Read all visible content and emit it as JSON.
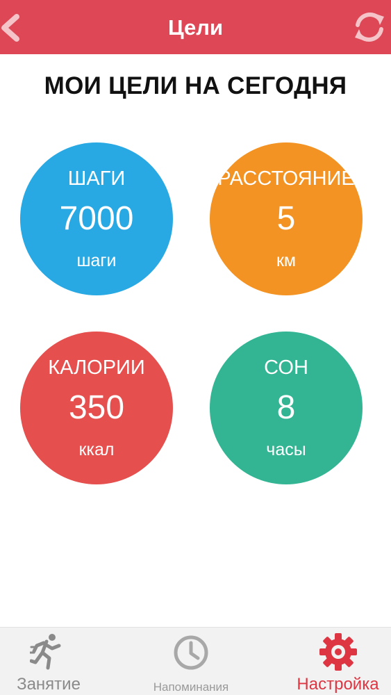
{
  "colors": {
    "header": "#dd4756",
    "steps": "#29a9e3",
    "distance": "#f39323",
    "calories": "#e5504e",
    "sleep": "#33b594",
    "tab_active": "#dd3642",
    "tab_inactive": "#8a8a8a"
  },
  "header": {
    "title": "Цели",
    "back_icon": "chevron-left-icon",
    "refresh_icon": "refresh-icon"
  },
  "page_heading": "МОИ ЦЕЛИ НА СЕГОДНЯ",
  "goals": {
    "steps": {
      "label": "ШАГИ",
      "value": "7000",
      "unit": "шаги"
    },
    "distance": {
      "label": "РАССТОЯНИЕ",
      "value": "5",
      "unit": "км"
    },
    "calories": {
      "label": "КАЛОРИИ",
      "value": "350",
      "unit": "ккал"
    },
    "sleep": {
      "label": "СОН",
      "value": "8",
      "unit": "часы"
    }
  },
  "tabs": [
    {
      "label": "Занятие",
      "icon": "running-person-icon",
      "active": false
    },
    {
      "label": "Напоминания",
      "icon": "clock-icon",
      "active": false
    },
    {
      "label": "Настройка",
      "icon": "gear-icon",
      "active": true
    }
  ]
}
